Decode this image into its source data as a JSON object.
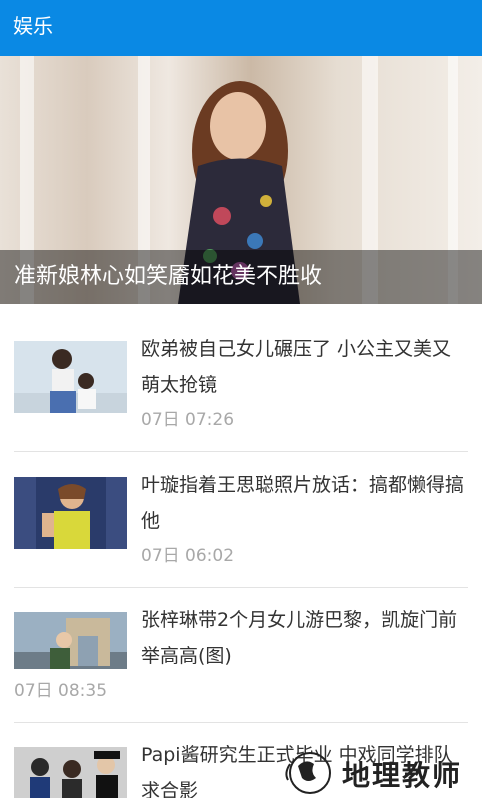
{
  "header": {
    "title": "娱乐"
  },
  "hero": {
    "caption": "准新娘林心如笑靥如花美不胜收"
  },
  "news": [
    {
      "title": "欧弟被自己女儿碾压了 小公主又美又萌太抢镜",
      "time": "07日 07:26"
    },
    {
      "title": "叶璇指着王思聪照片放话：搞都懒得搞他",
      "time": "07日 06:02"
    },
    {
      "title": "张梓琳带2个月女儿游巴黎，凯旋门前举高高(图)",
      "time": "07日 08:35"
    },
    {
      "title": "Papi酱研究生正式毕业 中戏同学排队求合影",
      "time": ""
    }
  ],
  "watermark": {
    "text": "地理教师"
  },
  "colors": {
    "accent": "#0a89e4",
    "timestamp": "#a8a8a8",
    "headline": "#333333"
  }
}
